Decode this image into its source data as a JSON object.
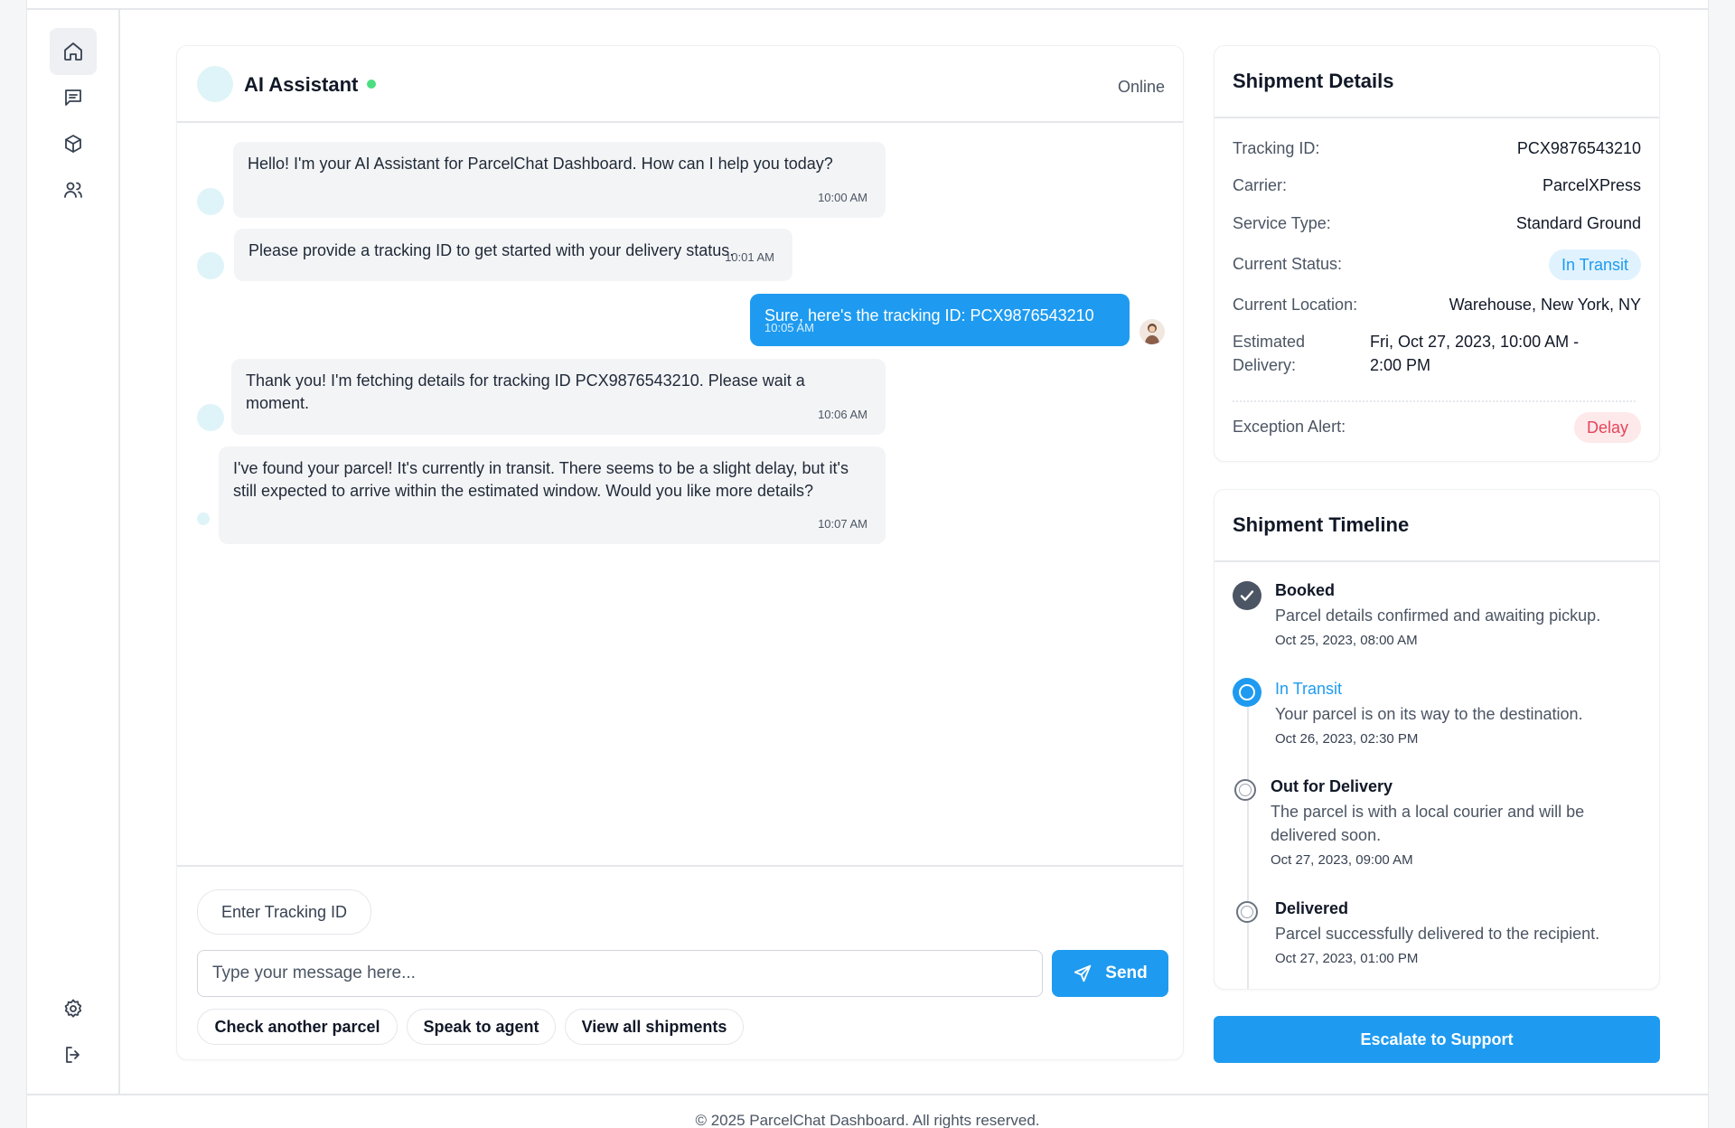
{
  "nav": {
    "items": [
      {
        "icon": "home-icon",
        "active": true
      },
      {
        "icon": "chat-icon",
        "active": false
      },
      {
        "icon": "package-icon",
        "active": false
      },
      {
        "icon": "users-icon",
        "active": false
      }
    ],
    "bottom": [
      {
        "icon": "settings-icon"
      },
      {
        "icon": "logout-icon"
      }
    ]
  },
  "chat": {
    "title": "AI Assistant",
    "status": "Online",
    "messages": [
      {
        "sender": "bot",
        "text": "Hello! I'm your AI Assistant for ParcelChat Dashboard. How can I help you today?",
        "time": "10:00 AM"
      },
      {
        "sender": "bot",
        "text": "Please provide a tracking ID to get started with your delivery status.",
        "time": "10:01 AM"
      },
      {
        "sender": "user",
        "text": "Sure, here's the tracking ID: PCX9876543210",
        "time": "10:05 AM"
      },
      {
        "sender": "bot",
        "text": "Thank you! I'm fetching details for tracking ID PCX9876543210. Please wait a moment.",
        "time": "10:06 AM"
      },
      {
        "sender": "bot",
        "text": "I've found your parcel! It's currently in transit. There seems to be a slight delay, but it's still expected to arrive within the estimated window. Would you like more details?",
        "time": "10:07 AM"
      }
    ],
    "tracking_pill": "Enter Tracking ID",
    "input_placeholder": "Type your message here...",
    "send_label": "Send",
    "quick_actions": [
      "Check another parcel",
      "Speak to agent",
      "View all shipments"
    ]
  },
  "shipment": {
    "title": "Shipment Details",
    "tracking_label": "Tracking ID:",
    "tracking_value": "PCX9876543210",
    "carrier_label": "Carrier:",
    "carrier_value": "ParcelXPress",
    "service_label": "Service Type:",
    "service_value": "Standard Ground",
    "status_label": "Current Status:",
    "status_value": "In Transit",
    "location_label": "Current Location:",
    "location_value": "Warehouse, New York, NY",
    "eta_label_1": "Estimated",
    "eta_label_2": "Delivery:",
    "eta_value_1": "Fri, Oct 27, 2023, 10:00 AM -",
    "eta_value_2": "2:00 PM",
    "exception_label": "Exception Alert:",
    "exception_value": "Delay"
  },
  "timeline": {
    "title": "Shipment Timeline",
    "steps": [
      {
        "title": "Booked",
        "desc": "Parcel details confirmed and awaiting pickup.",
        "date": "Oct 25, 2023, 08:00 AM",
        "state": "done"
      },
      {
        "title": "In Transit",
        "desc": "Your parcel is on its way to the destination.",
        "date": "Oct 26, 2023, 02:30 PM",
        "state": "current"
      },
      {
        "title": "Out for Delivery",
        "desc_1": "The parcel is with a local courier and will be",
        "desc_2": "delivered soon.",
        "date": "Oct 27, 2023, 09:00 AM",
        "state": "pending"
      },
      {
        "title": "Delivered",
        "desc": "Parcel successfully delivered to the recipient.",
        "date": "Oct 27, 2023, 01:00 PM",
        "state": "pending"
      }
    ]
  },
  "escalate_label": "Escalate to Support",
  "footer": "© 2025 ParcelChat Dashboard. All rights reserved.",
  "colors": {
    "accent": "#1e9bf0",
    "online": "#4ade80",
    "delay": "#e4455a",
    "done": "#4b5563"
  }
}
